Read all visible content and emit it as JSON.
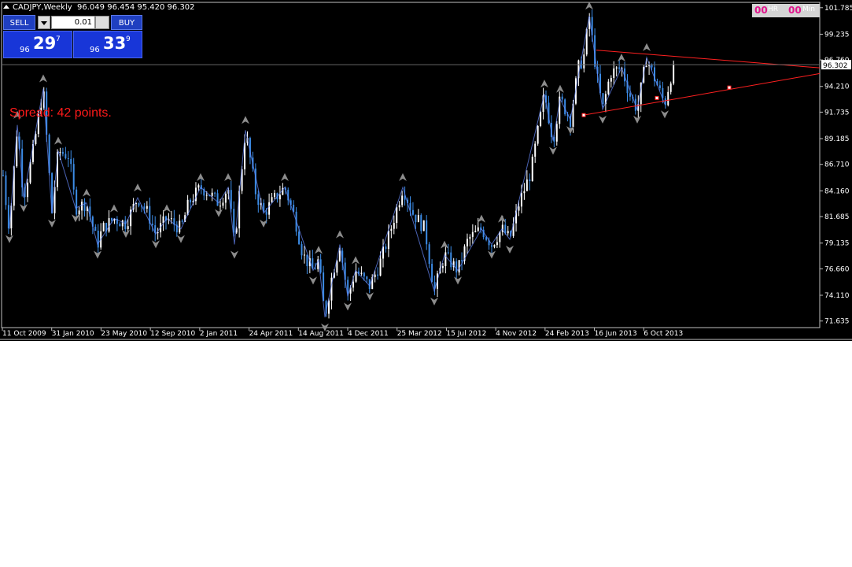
{
  "chart_window": {
    "title": "CADJPY,Weekly",
    "ohlc": "96.049 96.454 95.420 96.302"
  },
  "trade_panel": {
    "sell_label": "SELL",
    "buy_label": "BUY",
    "lot_value": "0.01",
    "sell_price": {
      "big": "96",
      "pips": "29",
      "point": "7"
    },
    "buy_price": {
      "big": "96",
      "pips": "33",
      "point": "9"
    }
  },
  "spread_text": "Spread: 42 points.",
  "timer": {
    "hours": "00",
    "hours_label": "HR",
    "minutes": "00",
    "minutes_label": "Min"
  },
  "current_price_label": "96.302",
  "colors": {
    "background": "#000000",
    "bull_candle": "#ffffff",
    "bear_candle": "#3c8ce6",
    "trendline": "#ff2020",
    "zigzag": "#6a8cff",
    "fractal": "#8c8c8c",
    "grid": "#3a3a3a"
  },
  "chart_data": {
    "type": "candlestick",
    "symbol": "CADJPY",
    "timeframe": "Weekly",
    "ylim": [
      71.0,
      102.3
    ],
    "y_ticks": [
      "101.785",
      "99.235",
      "96.760",
      "94.210",
      "91.735",
      "89.185",
      "86.710",
      "84.160",
      "81.685",
      "79.135",
      "76.660",
      "74.110",
      "71.635"
    ],
    "x_tick_labels": [
      "11 Oct 2009",
      "31 Jan 2010",
      "23 May 2010",
      "12 Sep 2010",
      "2 Jan 2011",
      "24 Apr 2011",
      "14 Aug 2011",
      "4 Dec 2011",
      "25 Mar 2012",
      "15 Jul 2012",
      "4 Nov 2012",
      "24 Feb 2013",
      "16 Jun 2013",
      "6 Oct 2013"
    ],
    "path_keypoints": [
      [
        0,
        89.0
      ],
      [
        6,
        84.0
      ],
      [
        12,
        80.5
      ],
      [
        22,
        90.5
      ],
      [
        30,
        83.5
      ],
      [
        42,
        88.0
      ],
      [
        55,
        94.0
      ],
      [
        66,
        82.0
      ],
      [
        74,
        88.0
      ],
      [
        88,
        87.5
      ],
      [
        96,
        82.5
      ],
      [
        110,
        83.0
      ],
      [
        124,
        79.0
      ],
      [
        130,
        80.5
      ],
      [
        145,
        81.5
      ],
      [
        160,
        81.0
      ],
      [
        175,
        83.5
      ],
      [
        188,
        82.0
      ],
      [
        198,
        80.0
      ],
      [
        212,
        81.5
      ],
      [
        230,
        80.5
      ],
      [
        240,
        83.0
      ],
      [
        255,
        84.5
      ],
      [
        265,
        84.0
      ],
      [
        278,
        83.0
      ],
      [
        290,
        84.5
      ],
      [
        298,
        79.0
      ],
      [
        312,
        90.0
      ],
      [
        325,
        84.0
      ],
      [
        335,
        82.0
      ],
      [
        350,
        83.5
      ],
      [
        362,
        84.5
      ],
      [
        375,
        81.5
      ],
      [
        385,
        78.0
      ],
      [
        398,
        76.5
      ],
      [
        405,
        77.5
      ],
      [
        413,
        72.0
      ],
      [
        422,
        76.0
      ],
      [
        432,
        79.0
      ],
      [
        442,
        74.0
      ],
      [
        452,
        76.5
      ],
      [
        470,
        75.0
      ],
      [
        482,
        77.0
      ],
      [
        495,
        80.0
      ],
      [
        512,
        84.5
      ],
      [
        525,
        82.0
      ],
      [
        540,
        80.5
      ],
      [
        552,
        74.5
      ],
      [
        565,
        78.0
      ],
      [
        582,
        76.5
      ],
      [
        595,
        79.5
      ],
      [
        612,
        80.5
      ],
      [
        625,
        79.0
      ],
      [
        638,
        80.5
      ],
      [
        648,
        79.5
      ],
      [
        660,
        83.0
      ],
      [
        675,
        86.0
      ],
      [
        692,
        93.5
      ],
      [
        703,
        89.0
      ],
      [
        712,
        93.0
      ],
      [
        725,
        91.0
      ],
      [
        735,
        96.0
      ],
      [
        742,
        97.0
      ],
      [
        749,
        101.0
      ],
      [
        758,
        95.5
      ],
      [
        766,
        92.0
      ],
      [
        776,
        95.5
      ],
      [
        790,
        96.0
      ],
      [
        800,
        93.5
      ],
      [
        810,
        92.0
      ],
      [
        822,
        97.0
      ],
      [
        832,
        95.0
      ],
      [
        845,
        92.5
      ],
      [
        852,
        95.0
      ],
      [
        858,
        96.3
      ]
    ],
    "triangle_trendlines": [
      {
        "from": [
          "Jun 2013",
          97.7
        ],
        "to": [
          "Jan 2014",
          96.0
        ]
      },
      {
        "from": [
          "Mar 2013",
          91.45
        ],
        "to": [
          "Jan 2014",
          95.45
        ]
      }
    ],
    "current_price": 96.302
  }
}
